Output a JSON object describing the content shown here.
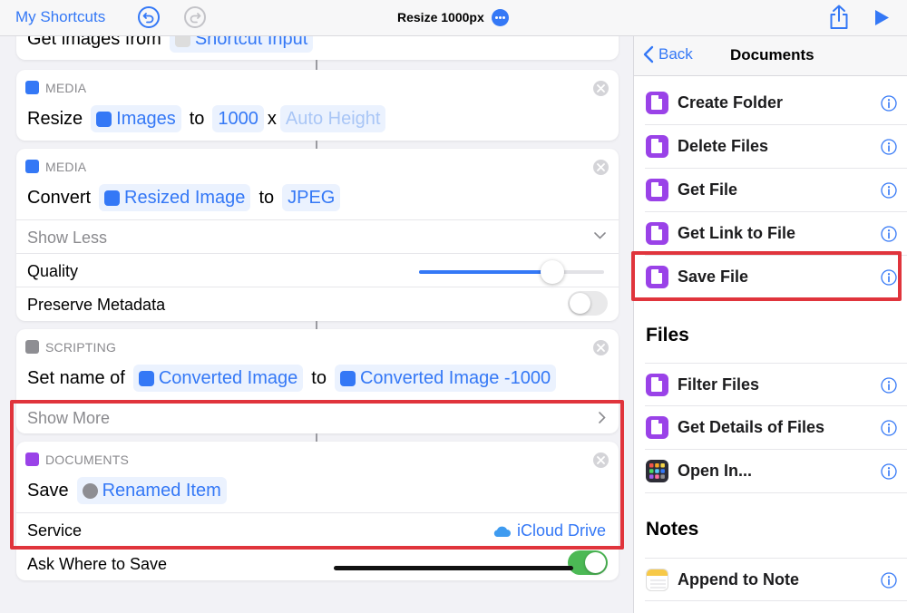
{
  "topbar": {
    "back_label": "My Shortcuts",
    "title": "Resize 1000px"
  },
  "editor": {
    "top_partial": {
      "word": "Get images from",
      "token": "Shortcut Input"
    },
    "resize": {
      "category": "MEDIA",
      "verb": "Resize",
      "token_images": "Images",
      "to": "to",
      "width": "1000",
      "x": "x",
      "height_placeholder": "Auto Height"
    },
    "convert": {
      "category": "MEDIA",
      "verb": "Convert",
      "token_image": "Resized Image",
      "to": "to",
      "format": "JPEG",
      "show_less": "Show Less",
      "quality_label": "Quality",
      "quality_level": 0.72,
      "preserve_label": "Preserve Metadata",
      "preserve_on": false
    },
    "setname": {
      "category": "SCRIPTING",
      "verb": "Set name of",
      "token_image": "Converted Image",
      "to": "to",
      "token_name": "Converted Image -1000",
      "show_more": "Show More"
    },
    "save": {
      "category": "DOCUMENTS",
      "verb": "Save",
      "token_item": "Renamed Item",
      "service_label": "Service",
      "service_value": "iCloud Drive",
      "ask_label": "Ask Where to Save",
      "ask_on": true
    }
  },
  "panel": {
    "back_label": "Back",
    "title": "Documents",
    "documents_items": [
      {
        "label": "Create Folder"
      },
      {
        "label": "Delete Files"
      },
      {
        "label": "Get File"
      },
      {
        "label": "Get Link to File"
      },
      {
        "label": "Save File"
      }
    ],
    "files_header": "Files",
    "files_items": [
      {
        "label": "Filter Files"
      },
      {
        "label": "Get Details of Files"
      },
      {
        "label": "Open In..."
      }
    ],
    "notes_header": "Notes",
    "notes_items": [
      {
        "label": "Append to Note"
      }
    ]
  },
  "colors": {
    "accent": "#3478f6",
    "documents_purple": "#9a42e8",
    "highlight_red": "#e0343c",
    "toggle_green": "#4cb955"
  }
}
